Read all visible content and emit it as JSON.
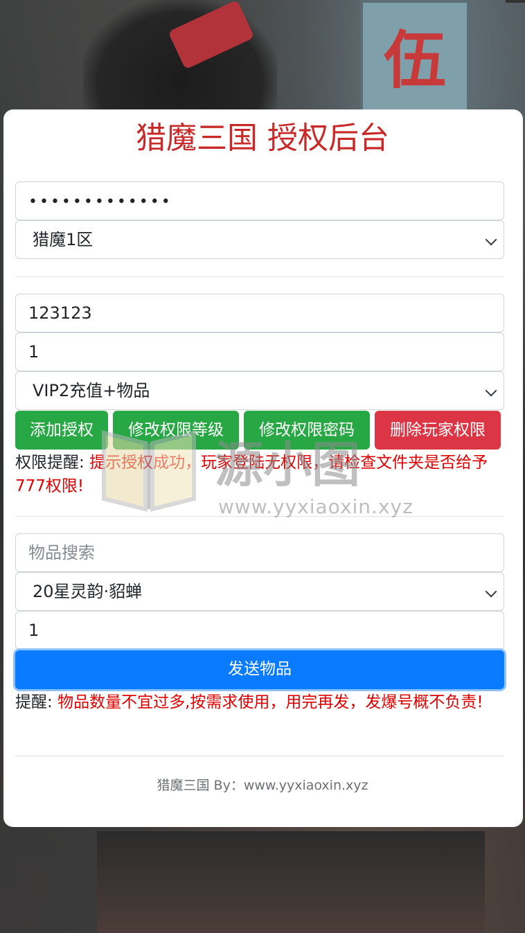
{
  "header": {
    "title": "猎魔三国 授权后台"
  },
  "auth": {
    "password_value": "•••••••••••••",
    "server_select": "猎魔1区"
  },
  "player": {
    "account_value": "123123",
    "level_value": "1",
    "permission_select": "VIP2充值+物品",
    "buttons": {
      "add": "添加授权",
      "modify_level": "修改权限等级",
      "modify_password": "修改权限密码",
      "delete": "删除玩家权限"
    },
    "notice_label": "权限提醒:",
    "notice_text": "提示授权成功，玩家登陆无权限，请检查文件夹是否给予777权限!"
  },
  "items": {
    "search_placeholder": "物品搜索",
    "item_select": "20星灵韵·貂蝉",
    "quantity_value": "1",
    "send_button": "发送物品",
    "notice_label": "提醒:",
    "notice_text": "物品数量不宜过多,按需求使用，用完再发，发爆号概不负责!"
  },
  "footer": {
    "text": "猎魔三国 By：www.yyxiaoxin.xyz"
  },
  "watermark": {
    "url": "www.yyxiaoxin.xyz",
    "logo": "源小图"
  },
  "colors": {
    "title": "#c82a2a",
    "green": "#28a745",
    "red": "#dc3545",
    "blue": "#0a7bff",
    "notice_red": "#e10000"
  }
}
